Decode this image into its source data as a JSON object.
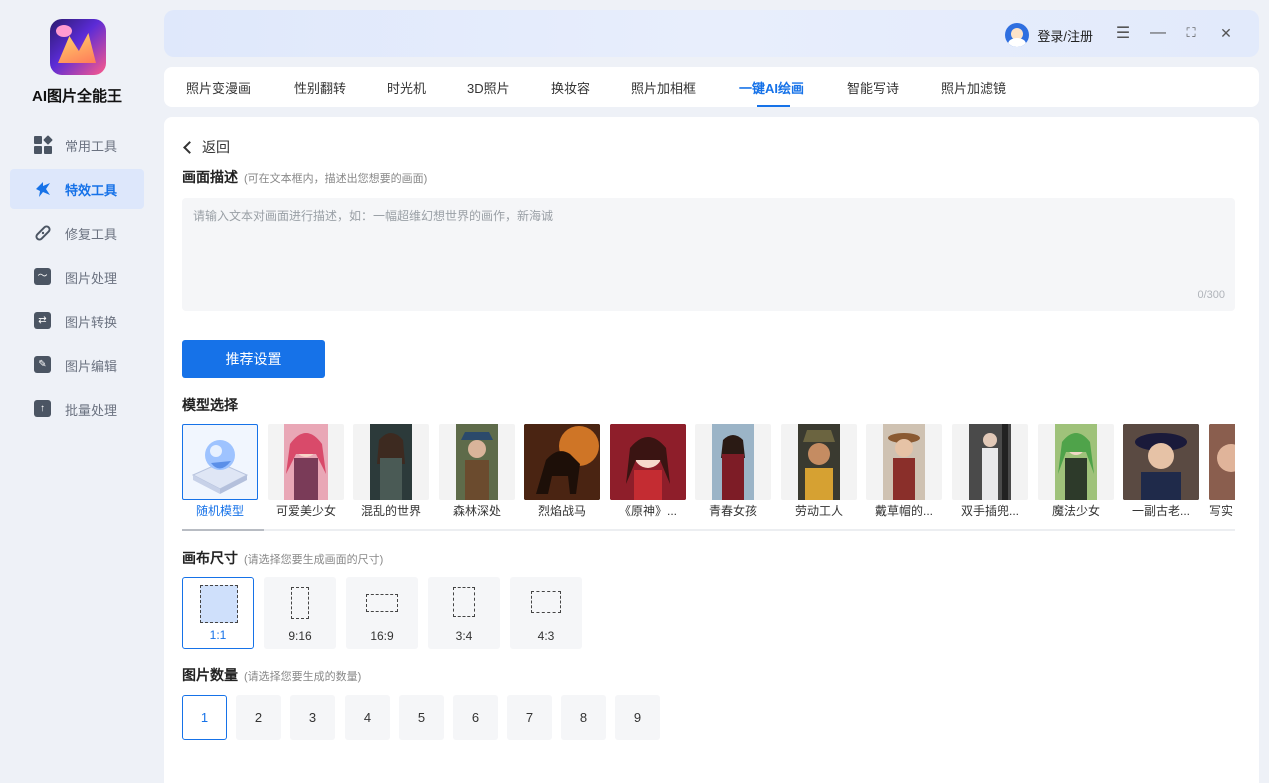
{
  "app": {
    "name": "AI图片全能王"
  },
  "sidebar": {
    "items": [
      {
        "label": "常用工具",
        "icon": "grid-icon",
        "active": false
      },
      {
        "label": "特效工具",
        "icon": "sparkle-icon",
        "active": true
      },
      {
        "label": "修复工具",
        "icon": "bandage-icon",
        "active": false
      },
      {
        "label": "图片处理",
        "icon": "image-icon",
        "active": false
      },
      {
        "label": "图片转换",
        "icon": "convert-icon",
        "active": false
      },
      {
        "label": "图片编辑",
        "icon": "edit-icon",
        "active": false
      },
      {
        "label": "批量处理",
        "icon": "upload-icon",
        "active": false
      }
    ]
  },
  "titlebar": {
    "login_label": "登录/注册",
    "menu_glyph": "☰",
    "minimize_glyph": "—",
    "fullscreen_glyph": "⛶",
    "close_glyph": "✕"
  },
  "tabs": [
    {
      "label": "照片变漫画"
    },
    {
      "label": "性别翻转"
    },
    {
      "label": "时光机"
    },
    {
      "label": "3D照片"
    },
    {
      "label": "换妆容"
    },
    {
      "label": "照片加相框"
    },
    {
      "label": "一键AI绘画",
      "active": true
    },
    {
      "label": "智能写诗"
    },
    {
      "label": "照片加滤镜"
    }
  ],
  "main": {
    "back_label": "返回",
    "desc_title": "画面描述",
    "desc_hint": "(可在文本框内，描述出您想要的画面)",
    "desc_placeholder": "请输入文本对画面进行描述，如：一幅超维幻想世界的画作，新海诚",
    "desc_value": "",
    "counter": "0/300",
    "recommend_label": "推荐设置",
    "model_title": "模型选择",
    "models": [
      {
        "label": "随机模型",
        "selected": true
      },
      {
        "label": "可爱美少女"
      },
      {
        "label": "混乱的世界"
      },
      {
        "label": "森林深处"
      },
      {
        "label": "烈焰战马"
      },
      {
        "label": "《原神》..."
      },
      {
        "label": "青春女孩"
      },
      {
        "label": "劳动工人"
      },
      {
        "label": "戴草帽的..."
      },
      {
        "label": "双手插兜..."
      },
      {
        "label": "魔法少女"
      },
      {
        "label": "一副古老..."
      },
      {
        "label": "写实"
      }
    ],
    "canvas_title": "画布尺寸",
    "canvas_hint": "(请选择您要生成画面的尺寸)",
    "ratios": [
      {
        "label": "1:1",
        "selected": true
      },
      {
        "label": "9:16"
      },
      {
        "label": "16:9"
      },
      {
        "label": "3:4"
      },
      {
        "label": "4:3"
      }
    ],
    "count_title": "图片数量",
    "count_hint": "(请选择您要生成的数量)",
    "counts": [
      "1",
      "2",
      "3",
      "4",
      "5",
      "6",
      "7",
      "8",
      "9"
    ],
    "count_selected": "1"
  },
  "colors": {
    "accent": "#1672e8",
    "sidebar_active_bg": "#dde7fb"
  }
}
